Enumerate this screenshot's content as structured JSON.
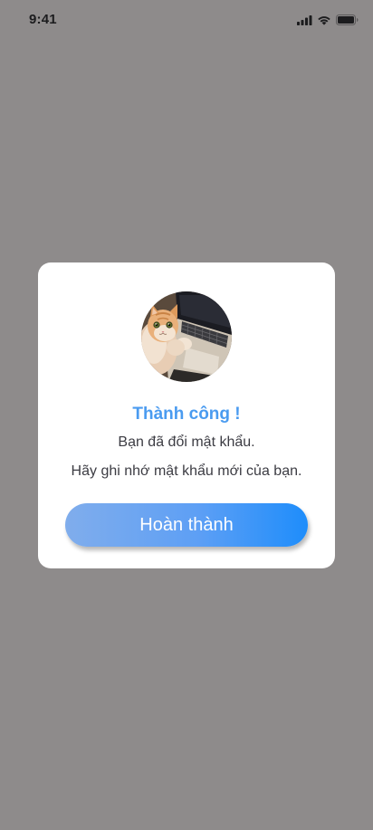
{
  "status_bar": {
    "time": "9:41",
    "icons": [
      "cellular-signal-icon",
      "wifi-icon",
      "battery-icon"
    ]
  },
  "dialog": {
    "avatar": "cat-on-laptop-photo",
    "title": "Thành công !",
    "message_line_1": "Bạn đã đổi mật khẩu.",
    "message_line_2": "Hãy ghi nhớ mật khẩu mới của bạn.",
    "button_label": "Hoàn thành"
  },
  "colors": {
    "overlay": "#8e8b8b",
    "dialog_background": "#ffffff",
    "title": "#4a9bf0",
    "button_gradient_start": "#80adec",
    "button_gradient_end": "#1e8dfb",
    "button_text": "#ffffff"
  }
}
